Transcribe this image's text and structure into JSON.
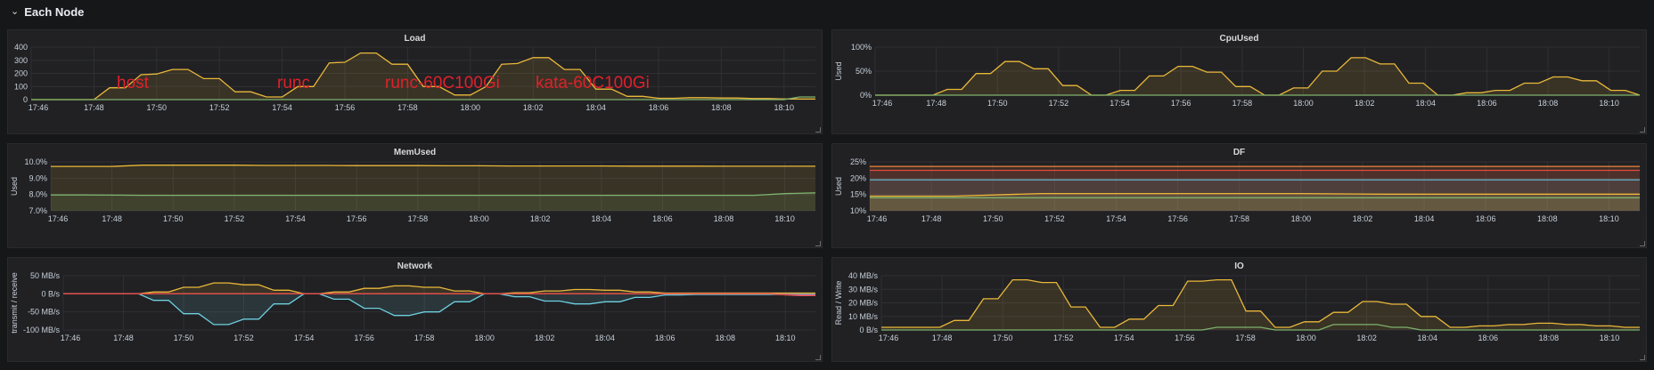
{
  "row": {
    "title": "Each Node",
    "chevron": "chevron-down-icon"
  },
  "time_ticks": [
    "17:46",
    "17:48",
    "17:50",
    "17:52",
    "17:54",
    "17:56",
    "17:58",
    "18:00",
    "18:02",
    "18:04",
    "18:06",
    "18:08",
    "18:10"
  ],
  "colors": {
    "yellow": "#eab839",
    "green": "#7eb26d",
    "blue": "#6ed0e0",
    "red": "#e24d42",
    "orange": "#ef843c",
    "lightblue": "#64b0c8",
    "purple": "#d683ce"
  },
  "panels": [
    {
      "id": "load",
      "title": "Load",
      "ylabel": "",
      "chart_data": {
        "type": "line",
        "x_range": [
          "17:46",
          "18:11"
        ],
        "yticks": [
          "400",
          "300",
          "200",
          "100",
          "0"
        ],
        "ylim": [
          0,
          400
        ],
        "annotations": [
          "host",
          "runc",
          "runc-60C100Gi",
          "kata-60C100Gi"
        ],
        "series": [
          {
            "color": "yellow",
            "fill": true,
            "values": [
              0,
              0,
              0,
              0,
              0,
              90,
              90,
              190,
              195,
              230,
              230,
              160,
              160,
              60,
              60,
              20,
              20,
              100,
              100,
              280,
              285,
              355,
              355,
              270,
              270,
              100,
              100,
              35,
              35,
              100,
              270,
              275,
              320,
              320,
              230,
              230,
              80,
              80,
              25,
              25,
              10,
              10,
              15,
              15,
              12,
              12,
              8,
              8,
              5,
              5,
              5
            ]
          },
          {
            "color": "green",
            "fill": false,
            "values": [
              0,
              0,
              0,
              0,
              0,
              0,
              0,
              0,
              0,
              0,
              0,
              0,
              0,
              0,
              0,
              0,
              0,
              0,
              0,
              0,
              0,
              0,
              0,
              0,
              0,
              0,
              0,
              0,
              0,
              0,
              0,
              0,
              0,
              0,
              0,
              0,
              0,
              0,
              0,
              0,
              0,
              0,
              0,
              0,
              0,
              0,
              0,
              0,
              0,
              20,
              20
            ]
          }
        ]
      }
    },
    {
      "id": "cpuused",
      "title": "CpuUsed",
      "ylabel": "Used",
      "chart_data": {
        "type": "line",
        "x_range": [
          "17:46",
          "18:11"
        ],
        "yticks": [
          "100%",
          "50%",
          "0%"
        ],
        "ylim": [
          0,
          100
        ],
        "series": [
          {
            "color": "yellow",
            "fill": true,
            "values": [
              0,
              0,
              0,
              0,
              0,
              12,
              12,
              45,
              45,
              70,
              70,
              55,
              55,
              20,
              20,
              0,
              0,
              10,
              10,
              40,
              40,
              60,
              60,
              48,
              48,
              18,
              18,
              0,
              0,
              15,
              15,
              50,
              50,
              78,
              78,
              65,
              65,
              25,
              25,
              0,
              0,
              5,
              5,
              10,
              10,
              25,
              25,
              38,
              38,
              30,
              30,
              10,
              10,
              0
            ]
          },
          {
            "color": "green",
            "fill": false,
            "values": [
              0,
              0,
              0,
              0,
              0,
              0,
              0,
              0,
              0,
              0,
              0,
              0,
              0,
              0,
              0,
              0,
              0,
              0,
              0,
              0,
              0,
              0,
              0,
              0,
              0,
              0,
              0,
              0,
              0,
              0,
              0,
              0,
              0,
              0,
              0,
              0,
              0,
              0,
              0,
              0,
              0,
              0,
              0,
              0,
              0,
              0,
              0,
              0,
              0,
              0,
              0,
              0,
              0,
              0
            ]
          }
        ]
      }
    },
    {
      "id": "memused",
      "title": "MemUsed",
      "ylabel": "Used",
      "chart_data": {
        "type": "line",
        "x_range": [
          "17:46",
          "18:11"
        ],
        "yticks": [
          "10.0%",
          "9.0%",
          "8.0%",
          "7.0%"
        ],
        "ylim": [
          7,
          10
        ],
        "series": [
          {
            "color": "yellow",
            "fill": true,
            "values": [
              9.72,
              9.72,
              9.72,
              9.8,
              9.8,
              9.8,
              9.8,
              9.78,
              9.78,
              9.78,
              9.77,
              9.77,
              9.77,
              9.76,
              9.76,
              9.75,
              9.75,
              9.75,
              9.75,
              9.74,
              9.74,
              9.74,
              9.73,
              9.73,
              9.73,
              9.73
            ]
          },
          {
            "color": "green",
            "fill": true,
            "values": [
              7.97,
              7.97,
              7.96,
              7.95,
              7.95,
              7.95,
              7.95,
              7.95,
              7.95,
              7.95,
              7.95,
              7.95,
              7.95,
              7.95,
              7.95,
              7.95,
              7.95,
              7.95,
              7.95,
              7.95,
              7.95,
              7.95,
              7.95,
              7.95,
              8.05,
              8.1
            ]
          }
        ]
      }
    },
    {
      "id": "df",
      "title": "DF",
      "ylabel": "Used",
      "chart_data": {
        "type": "line",
        "x_range": [
          "17:46",
          "18:11"
        ],
        "yticks": [
          "25%",
          "20%",
          "15%",
          "10%"
        ],
        "ylim": [
          10,
          25
        ],
        "series": [
          {
            "color": "orange",
            "fill": true,
            "values": [
              23.6,
              23.6,
              23.6,
              23.6,
              23.6,
              23.6,
              23.6,
              23.6,
              23.6,
              23.6
            ]
          },
          {
            "color": "red",
            "fill": true,
            "values": [
              22.4,
              22.4,
              22.4,
              22.4,
              22.4,
              22.4,
              22.4,
              22.4,
              22.4,
              22.4
            ]
          },
          {
            "color": "lightblue",
            "fill": true,
            "values": [
              19.5,
              19.5,
              19.5,
              19.5,
              19.5,
              19.5,
              19.5,
              19.5,
              19.5,
              19.5
            ]
          },
          {
            "color": "yellow",
            "fill": true,
            "values": [
              14.5,
              14.5,
              15.3,
              15.3,
              15.3,
              15.3,
              15.1,
              15.1,
              15.1,
              15.1
            ]
          },
          {
            "color": "green",
            "fill": true,
            "values": [
              14.0,
              14.0,
              14.0,
              14.0,
              14.0,
              14.0,
              14.0,
              14.0,
              14.0,
              14.0
            ]
          }
        ]
      }
    },
    {
      "id": "network",
      "title": "Network",
      "ylabel": "transmit / receive",
      "chart_data": {
        "type": "line",
        "x_range": [
          "17:46",
          "18:11"
        ],
        "yticks": [
          "50 MB/s",
          "0 B/s",
          "-50 MB/s",
          "-100 MB/s"
        ],
        "ylim": [
          -100,
          50
        ],
        "series": [
          {
            "color": "yellow",
            "fill": true,
            "values": [
              0,
              0,
              0,
              0,
              0,
              0,
              5,
              5,
              18,
              18,
              30,
              30,
              25,
              25,
              10,
              10,
              0,
              0,
              5,
              5,
              15,
              15,
              22,
              22,
              18,
              18,
              8,
              8,
              0,
              0,
              3,
              3,
              8,
              8,
              12,
              12,
              10,
              10,
              5,
              5,
              2,
              2,
              2,
              2,
              2,
              2,
              2,
              2,
              2,
              2,
              2
            ]
          },
          {
            "color": "blue",
            "fill": true,
            "values": [
              0,
              0,
              0,
              0,
              0,
              0,
              -18,
              -18,
              -55,
              -55,
              -85,
              -85,
              -70,
              -70,
              -28,
              -28,
              0,
              0,
              -15,
              -15,
              -40,
              -40,
              -60,
              -60,
              -50,
              -50,
              -22,
              -22,
              0,
              0,
              -8,
              -8,
              -20,
              -20,
              -28,
              -28,
              -22,
              -22,
              -10,
              -10,
              -3,
              -3,
              -2,
              -2,
              -2,
              -2,
              -2,
              -2,
              -2,
              -2,
              -2
            ]
          },
          {
            "color": "purple",
            "fill": false,
            "values": [
              0,
              0,
              0,
              0,
              0,
              0,
              0,
              0,
              0,
              0,
              0,
              0,
              0,
              0,
              0,
              0,
              0,
              0,
              0,
              0,
              0,
              0,
              0,
              0,
              0,
              0,
              0,
              0,
              0,
              0,
              0,
              0,
              0,
              0,
              0,
              0,
              0,
              0,
              0,
              0,
              0,
              0,
              0,
              0,
              0,
              0,
              0,
              0,
              -2,
              -3,
              -3
            ]
          },
          {
            "color": "red",
            "fill": false,
            "values": [
              0,
              0,
              0,
              0,
              0,
              0,
              0,
              0,
              0,
              0,
              0,
              0,
              0,
              0,
              0,
              0,
              0,
              0,
              0,
              0,
              0,
              0,
              0,
              0,
              0,
              0,
              0,
              0,
              0,
              0,
              0,
              0,
              0,
              0,
              0,
              0,
              0,
              0,
              0,
              0,
              0,
              0,
              0,
              0,
              0,
              0,
              0,
              0,
              -3,
              -5,
              -5
            ]
          }
        ]
      }
    },
    {
      "id": "io",
      "title": "IO",
      "ylabel": "Read / Write",
      "chart_data": {
        "type": "line",
        "x_range": [
          "17:46",
          "18:11"
        ],
        "yticks": [
          "40 MB/s",
          "30 MB/s",
          "20 MB/s",
          "10 MB/s",
          "0 B/s"
        ],
        "ylim": [
          0,
          40
        ],
        "series": [
          {
            "color": "yellow",
            "fill": true,
            "values": [
              2,
              2,
              2,
              2,
              2,
              7,
              7,
              23,
              23,
              37,
              37,
              35,
              35,
              17,
              17,
              2,
              2,
              8,
              8,
              18,
              18,
              36,
              36,
              37,
              37,
              14,
              14,
              2,
              2,
              6,
              6,
              13,
              13,
              21,
              21,
              19,
              19,
              10,
              10,
              2,
              2,
              3,
              3,
              4,
              4,
              5,
              5,
              4,
              4,
              3,
              3,
              2,
              2
            ]
          },
          {
            "color": "green",
            "fill": false,
            "values": [
              0,
              0,
              0,
              0,
              0,
              0,
              0,
              0,
              0,
              0,
              0,
              0,
              0,
              0,
              0,
              0,
              0,
              0,
              0,
              0,
              0,
              0,
              0,
              2,
              2,
              2,
              2,
              0,
              0,
              0,
              0,
              4,
              4,
              4,
              4,
              2,
              2,
              0,
              0,
              0,
              0,
              0,
              0,
              0,
              0,
              0,
              0,
              0,
              0,
              0,
              0,
              0,
              0
            ]
          }
        ]
      }
    }
  ]
}
